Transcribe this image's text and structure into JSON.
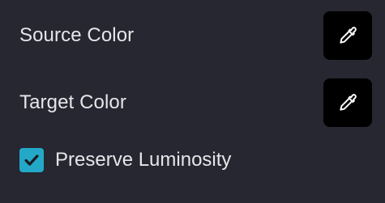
{
  "panel": {
    "source": {
      "label": "Source Color",
      "picker_icon": "eyedropper-icon"
    },
    "target": {
      "label": "Target Color",
      "picker_icon": "eyedropper-icon"
    },
    "preserve_luminosity": {
      "label": "Preserve Luminosity",
      "checked": true,
      "icon": "checkmark-icon"
    }
  },
  "colors": {
    "background": "#262730",
    "text": "#e6e6ea",
    "picker_background": "#000000",
    "checkbox_accent": "#24a8c7"
  }
}
